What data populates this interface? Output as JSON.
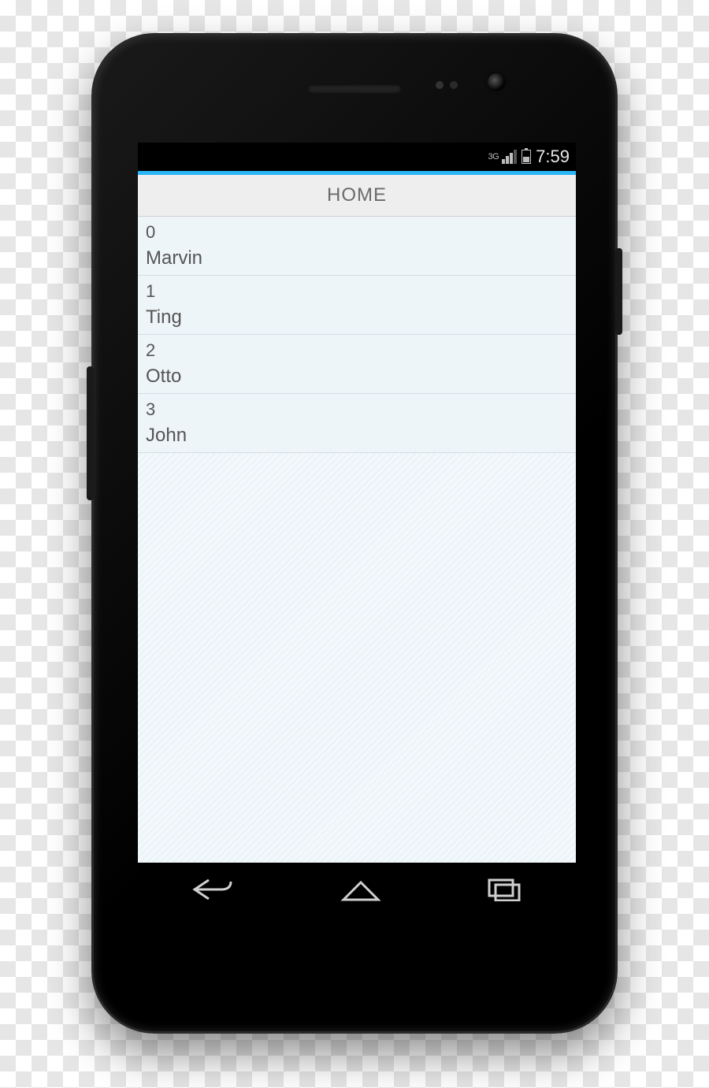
{
  "status_bar": {
    "network": "3G",
    "time": "7:59"
  },
  "header": {
    "title": "HOME"
  },
  "list": {
    "items": [
      {
        "index": "0",
        "name": "Marvin"
      },
      {
        "index": "1",
        "name": "Ting"
      },
      {
        "index": "2",
        "name": "Otto"
      },
      {
        "index": "3",
        "name": "John"
      }
    ]
  }
}
